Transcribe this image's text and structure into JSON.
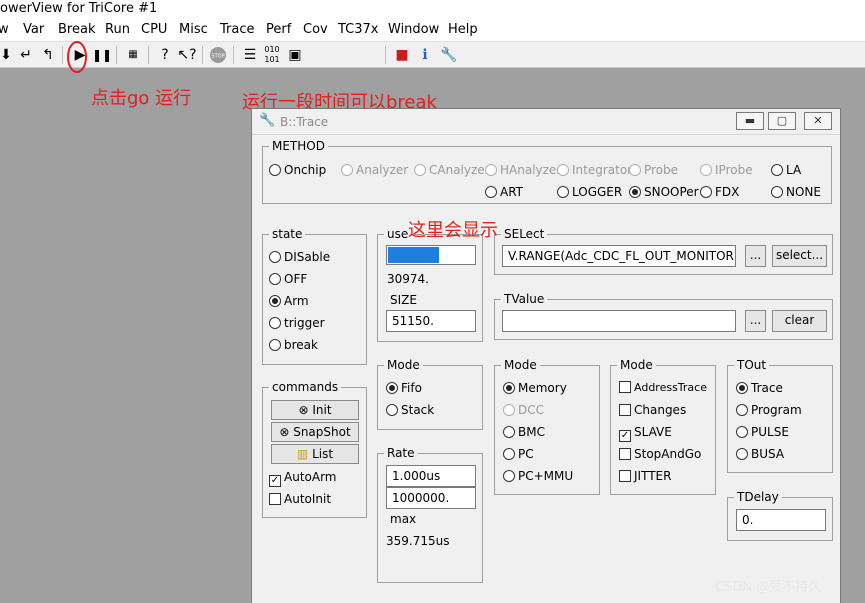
{
  "app": {
    "title": "owerView for TriCore #1"
  },
  "menu": [
    "w",
    "Var",
    "Break",
    "Run",
    "CPU",
    "Misc",
    "Trace",
    "Perf",
    "Cov",
    "TC37x",
    "Window",
    "Help"
  ],
  "toolbar": {
    "icons": [
      "step-down-icon",
      "step-over-icon",
      "step-return-icon",
      "go-icon",
      "break-icon",
      "register-icon",
      "help-icon",
      "context-help-icon",
      "stop-icon",
      "list-icon",
      "memory-dump-icon",
      "chip-icon",
      "trace-config-icon",
      "info-icon",
      "settings-icon"
    ],
    "stop_label": "STOP"
  },
  "annotations": {
    "go_hint": "点击go 运行",
    "break_hint": "运行一段时间可以break",
    "display_hint": "这里会显示"
  },
  "window": {
    "title": "B::Trace",
    "controls": [
      "minimize",
      "restore",
      "close"
    ]
  },
  "method": {
    "label": "METHOD",
    "options": [
      {
        "label": "Onchip",
        "selected": false,
        "disabled": false
      },
      {
        "label": "Analyzer",
        "selected": false,
        "disabled": true
      },
      {
        "label": "CAnalyzer",
        "selected": false,
        "disabled": true
      },
      {
        "label": "HAnalyzer",
        "selected": false,
        "disabled": true
      },
      {
        "label": "Integrator",
        "selected": false,
        "disabled": true
      },
      {
        "label": "Probe",
        "selected": false,
        "disabled": true
      },
      {
        "label": "IProbe",
        "selected": false,
        "disabled": true
      },
      {
        "label": "LA",
        "selected": false,
        "disabled": false
      },
      {
        "label": "ART",
        "selected": false,
        "disabled": false
      },
      {
        "label": "LOGGER",
        "selected": false,
        "disabled": false
      },
      {
        "label": "SNOOPer",
        "selected": true,
        "disabled": false
      },
      {
        "label": "FDX",
        "selected": false,
        "disabled": false
      },
      {
        "label": "NONE",
        "selected": false,
        "disabled": false
      }
    ]
  },
  "state": {
    "label": "state",
    "options": [
      {
        "label": "DISable",
        "selected": false
      },
      {
        "label": "OFF",
        "selected": false
      },
      {
        "label": "Arm",
        "selected": true
      },
      {
        "label": "trigger",
        "selected": false
      },
      {
        "label": "break",
        "selected": false
      }
    ]
  },
  "used": {
    "label": "use",
    "fill_percent": 60,
    "value": "30974.",
    "size_label": "SIZE",
    "size_value": "51150."
  },
  "select": {
    "label": "SELect",
    "value": "V.RANGE(Adc_CDC_FL_OUT_MONITOR",
    "ellipsis": "...",
    "button": "select..."
  },
  "tvalue": {
    "label": "TValue",
    "value": "",
    "ellipsis": "...",
    "button": "clear"
  },
  "commands": {
    "label": "commands",
    "buttons": [
      "Init",
      "SnapShot",
      "List"
    ],
    "checks": [
      {
        "label": "AutoArm",
        "checked": true
      },
      {
        "label": "AutoInit",
        "checked": false
      }
    ]
  },
  "mode1": {
    "label": "Mode",
    "options": [
      {
        "label": "Fifo",
        "selected": true
      },
      {
        "label": "Stack",
        "selected": false
      }
    ]
  },
  "mode2": {
    "label": "Mode",
    "options": [
      {
        "label": "Memory",
        "selected": true,
        "disabled": false
      },
      {
        "label": "DCC",
        "selected": false,
        "disabled": true
      },
      {
        "label": "BMC",
        "selected": false,
        "disabled": false
      },
      {
        "label": "PC",
        "selected": false,
        "disabled": false
      },
      {
        "label": "PC+MMU",
        "selected": false,
        "disabled": false
      }
    ]
  },
  "mode3": {
    "label": "Mode",
    "checks": [
      {
        "label": "AddressTrace",
        "checked": false
      },
      {
        "label": "Changes",
        "checked": false
      },
      {
        "label": "SLAVE",
        "checked": true
      },
      {
        "label": "StopAndGo",
        "checked": false
      },
      {
        "label": "JITTER",
        "checked": false
      }
    ]
  },
  "tout": {
    "label": "TOut",
    "options": [
      {
        "label": "Trace",
        "selected": true
      },
      {
        "label": "Program",
        "selected": false
      },
      {
        "label": "PULSE",
        "selected": false
      },
      {
        "label": "BUSA",
        "selected": false
      }
    ]
  },
  "rate": {
    "label": "Rate",
    "value1": "1.000us",
    "value2": "1000000.",
    "max_label": "max",
    "max_value": "359.715us"
  },
  "tdelay": {
    "label": "TDelay",
    "value": "0."
  },
  "watermark": "CSDN @爱不持久"
}
